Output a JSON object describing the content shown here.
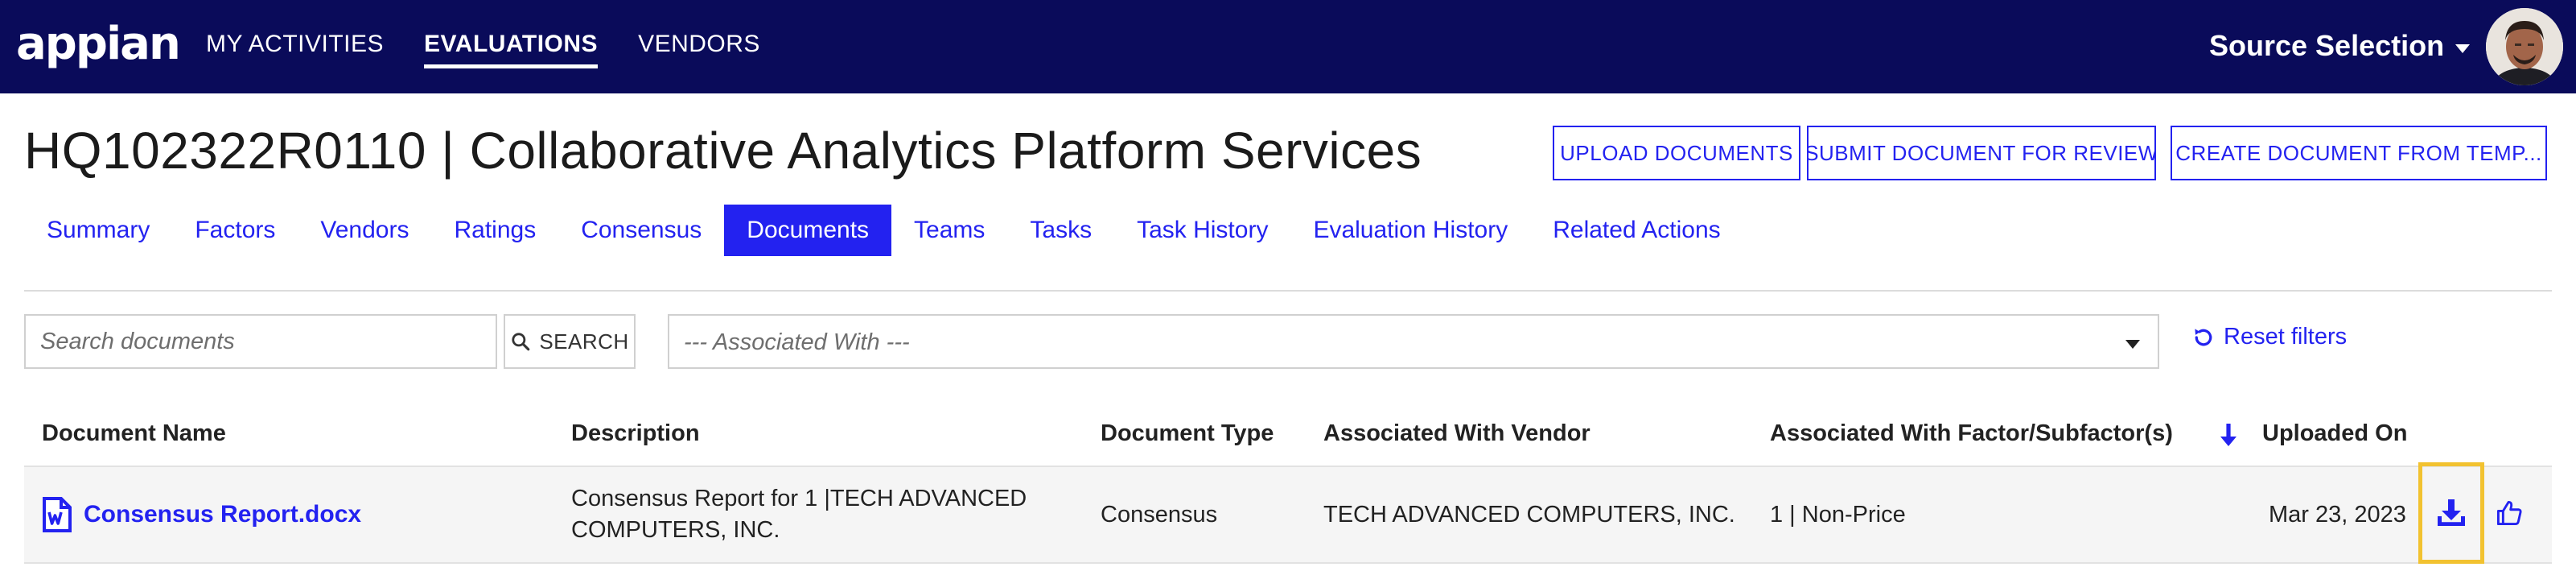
{
  "app": {
    "logo": "appian"
  },
  "nav": {
    "items": [
      {
        "label": "MY ACTIVITIES"
      },
      {
        "label": "EVALUATIONS"
      },
      {
        "label": "VENDORS"
      }
    ],
    "active": "EVALUATIONS",
    "site_label": "Source Selection"
  },
  "page": {
    "title": "HQ102322R0110 | Collaborative Analytics Platform Services"
  },
  "actions": {
    "upload": "UPLOAD DOCUMENTS",
    "submit": "SUBMIT DOCUMENT FOR REVIEW",
    "create": "CREATE DOCUMENT FROM TEMP..."
  },
  "tabs": [
    {
      "label": "Summary"
    },
    {
      "label": "Factors"
    },
    {
      "label": "Vendors"
    },
    {
      "label": "Ratings"
    },
    {
      "label": "Consensus"
    },
    {
      "label": "Documents"
    },
    {
      "label": "Teams"
    },
    {
      "label": "Tasks"
    },
    {
      "label": "Task History"
    },
    {
      "label": "Evaluation History"
    },
    {
      "label": "Related Actions"
    }
  ],
  "active_tab": "Documents",
  "filters": {
    "search_placeholder": "Search documents",
    "search_label": "SEARCH",
    "associated_with": "--- Associated With ---",
    "reset_label": "Reset filters"
  },
  "table": {
    "columns": {
      "name": "Document Name",
      "description": "Description",
      "type": "Document Type",
      "vendor": "Associated With Vendor",
      "factor": "Associated With Factor/Subfactor(s)",
      "uploaded": "Uploaded On"
    },
    "sort": {
      "column": "Uploaded On",
      "direction": "descending"
    },
    "rows": [
      {
        "name": "Consensus Report.docx",
        "description_line1": "Consensus Report for 1 |TECH ADVANCED",
        "description_line2": "COMPUTERS, INC.",
        "type": "Consensus",
        "vendor": "TECH ADVANCED COMPUTERS, INC.",
        "factor": "1 | Non-Price",
        "uploaded": "Mar 23, 2023"
      }
    ]
  },
  "colors": {
    "nav_bg": "#0a0b5a",
    "accent": "#2322f0",
    "highlight": "#f2c230",
    "row_bg": "#f5f5f5"
  },
  "icons": {
    "doc": "word-document-icon",
    "download": "download-icon",
    "thumb": "thumbs-up-icon",
    "reset": "reset-icon",
    "search": "search-icon",
    "sort": "sort-down-arrow-icon"
  }
}
